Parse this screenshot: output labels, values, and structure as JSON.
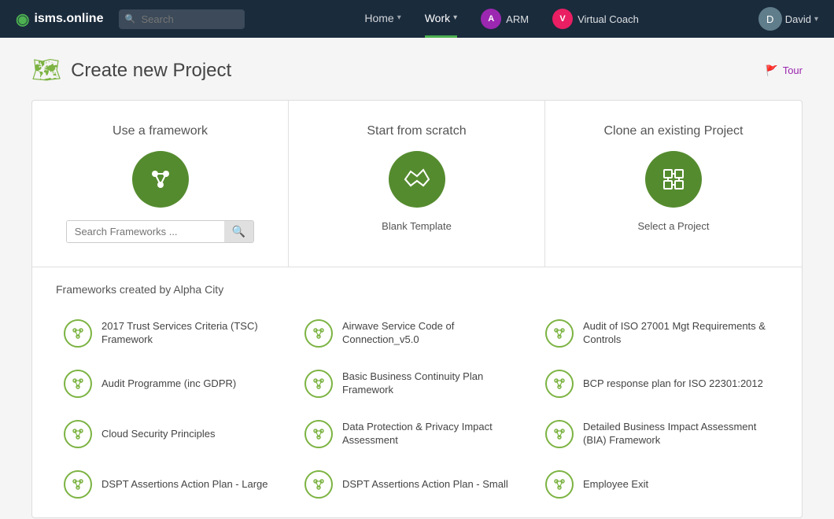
{
  "nav": {
    "logo_text": "isms.online",
    "search_placeholder": "Search",
    "links": [
      {
        "label": "Home",
        "active": false
      },
      {
        "label": "Work",
        "active": true
      },
      {
        "label": "ARM",
        "active": false
      },
      {
        "label": "Virtual Coach",
        "active": false
      }
    ],
    "user_label": "David"
  },
  "page": {
    "title": "Create new Project",
    "tour_label": "Tour"
  },
  "options": [
    {
      "title": "Use a framework",
      "icon": "⋯",
      "search_placeholder": "Search Frameworks ..."
    },
    {
      "title": "Start from scratch",
      "icon": "🗺",
      "label": "Blank Template"
    },
    {
      "title": "Clone an existing Project",
      "icon": "❖",
      "label": "Select a Project"
    }
  ],
  "frameworks_section_title": "Frameworks created by Alpha City",
  "frameworks": [
    {
      "name": "2017 Trust Services Criteria (TSC) Framework"
    },
    {
      "name": "Airwave Service Code of Connection_v5.0"
    },
    {
      "name": "Audit of ISO 27001 Mgt Requirements & Controls"
    },
    {
      "name": "Audit Programme (inc GDPR)"
    },
    {
      "name": "Basic Business Continuity Plan Framework"
    },
    {
      "name": "BCP response plan for ISO 22301:2012"
    },
    {
      "name": "Cloud Security Principles"
    },
    {
      "name": "Data Protection & Privacy Impact Assessment"
    },
    {
      "name": "Detailed Business Impact Assessment (BIA) Framework"
    },
    {
      "name": "DSPT Assertions Action Plan - Large"
    },
    {
      "name": "DSPT Assertions Action Plan - Small"
    },
    {
      "name": "Employee Exit"
    }
  ]
}
